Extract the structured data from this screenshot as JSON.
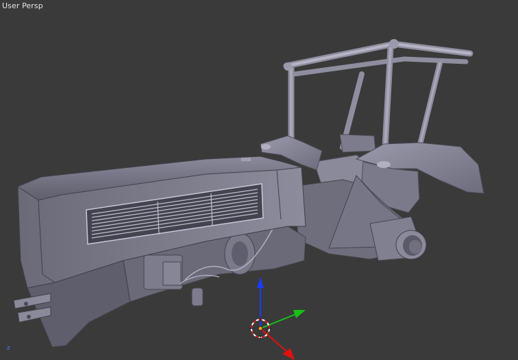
{
  "viewport": {
    "view_label": "User Persp",
    "background": "#3a3a3a",
    "model_color": "#7a7a8a",
    "axis_colors": {
      "x": "#e01010",
      "y": "#10c010",
      "z": "#1030ff"
    }
  },
  "gizmo": {
    "axis_label_z": "z"
  },
  "icons": [
    "3d-cursor-icon",
    "origin-marker-icon"
  ]
}
